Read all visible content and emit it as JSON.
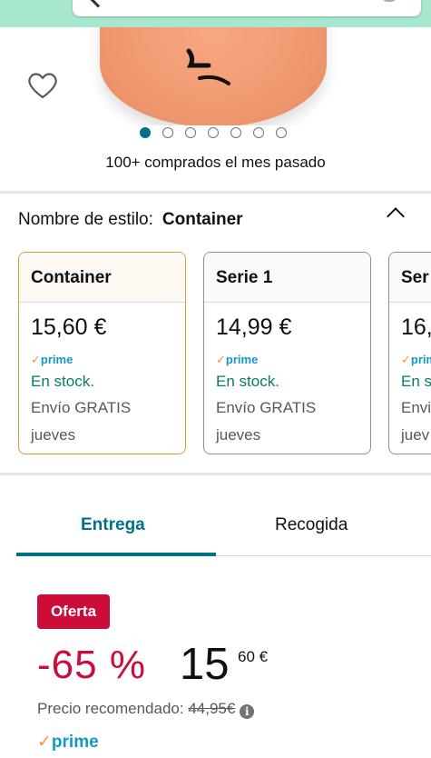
{
  "colors": {
    "accent": "#007185",
    "deal": "#cc0c39",
    "in_stock": "#067d62",
    "prime": "#1399c6"
  },
  "carousel": {
    "total": 7,
    "active": 0
  },
  "bought_text": "100+ comprados el mes pasado",
  "style": {
    "label": "Nombre de estilo:",
    "value": "Container"
  },
  "cards": [
    {
      "name": "Container",
      "price": "15,60 €",
      "prime": "prime",
      "stock": "En stock.",
      "shipping": "Envío GRATIS",
      "day": "jueves",
      "selected": true
    },
    {
      "name": "Serie 1",
      "price": "14,99 €",
      "prime": "prime",
      "stock": "En stock.",
      "shipping": "Envío GRATIS",
      "day": "jueves",
      "selected": false
    },
    {
      "name": "Ser",
      "price": "16,",
      "prime": "prim",
      "stock": "En s",
      "shipping": "Envi",
      "day": "juev",
      "selected": false
    }
  ],
  "tabs": {
    "delivery": "Entrega",
    "pickup": "Recogida"
  },
  "offer": {
    "badge": "Oferta",
    "discount": "-65 %",
    "price_whole": "15",
    "price_fraction": "60 €",
    "rrp_label": "Precio recomendado:",
    "rrp_value": "44,95€",
    "prime": "prime"
  }
}
